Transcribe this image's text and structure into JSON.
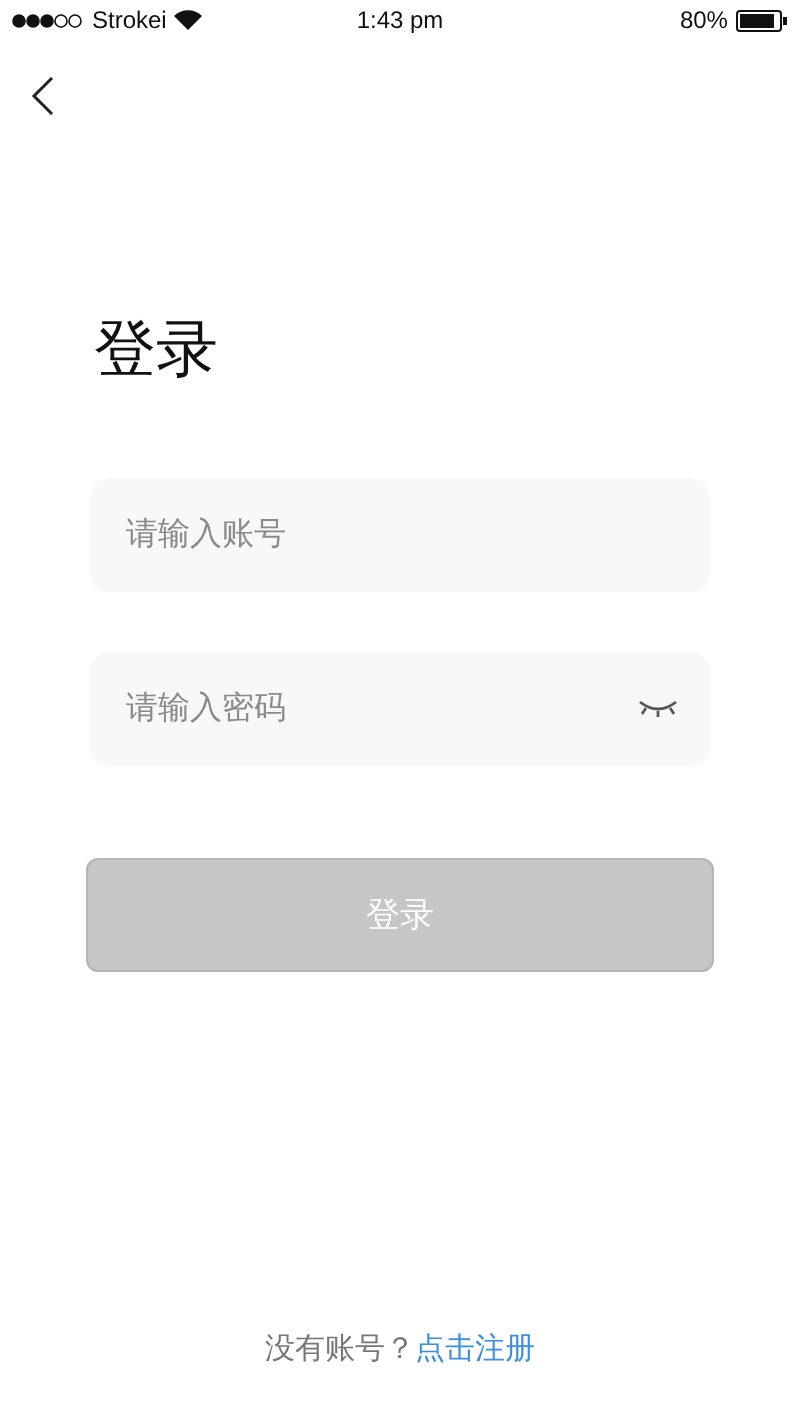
{
  "status_bar": {
    "carrier": "Strokei",
    "time": "1:43 pm",
    "battery": "80%"
  },
  "title": "登录",
  "fields": [
    {
      "kind": "text",
      "placeholder": "请输入账号"
    },
    {
      "kind": "password",
      "placeholder": "请输入密码"
    }
  ],
  "login_button": {
    "label": "登录",
    "disabled": true
  },
  "footer": {
    "prompt": "没有账号？",
    "link": "点击注册"
  }
}
